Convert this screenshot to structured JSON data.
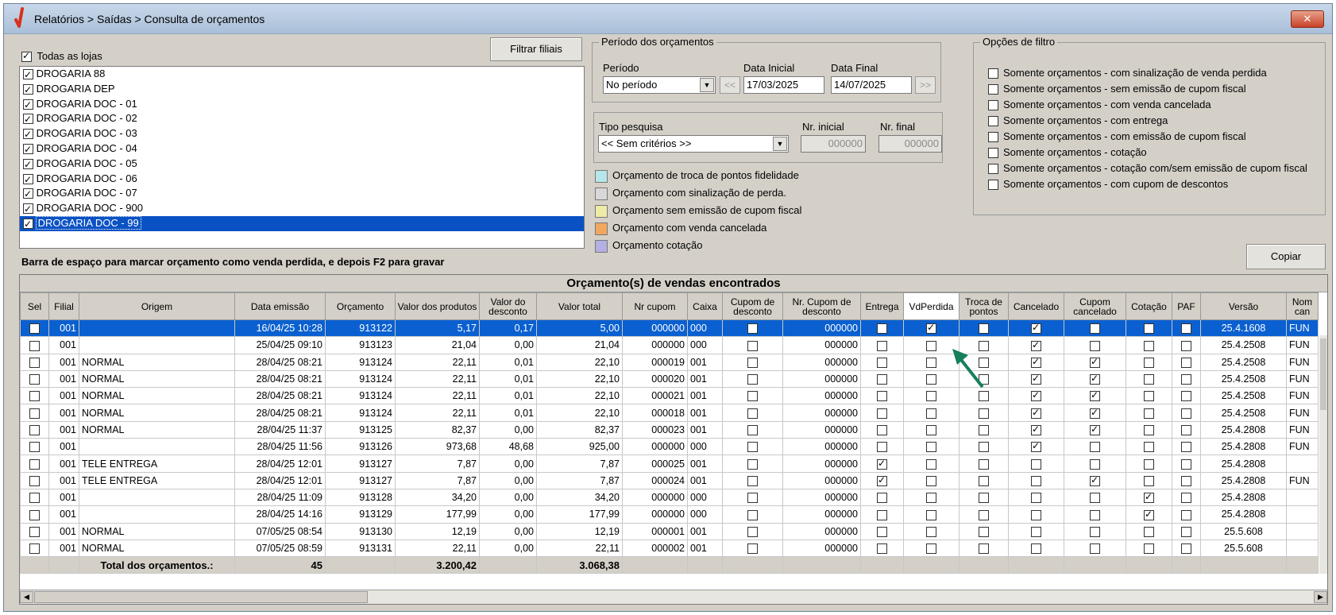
{
  "window": {
    "title": "Relatórios > Saídas > Consulta de orçamentos",
    "close_label": "✕"
  },
  "stores": {
    "all_label": "Todas as lojas",
    "all_checked": true,
    "filter_button": "Filtrar filiais",
    "items": [
      {
        "name": "DROGARIA 88",
        "checked": true
      },
      {
        "name": "DROGARIA DEP",
        "checked": true
      },
      {
        "name": "DROGARIA DOC - 01",
        "checked": true
      },
      {
        "name": "DROGARIA DOC - 02",
        "checked": true
      },
      {
        "name": "DROGARIA DOC - 03",
        "checked": true
      },
      {
        "name": "DROGARIA DOC - 04",
        "checked": true
      },
      {
        "name": "DROGARIA DOC - 05",
        "checked": true
      },
      {
        "name": "DROGARIA DOC - 06",
        "checked": true
      },
      {
        "name": "DROGARIA DOC - 07",
        "checked": true
      },
      {
        "name": "DROGARIA DOC - 900",
        "checked": true
      },
      {
        "name": "DROGARIA DOC - 99",
        "checked": true
      }
    ],
    "selected_index": 10
  },
  "period": {
    "group_title": "Período dos orçamentos",
    "period_label": "Período",
    "period_value": "No período",
    "start_label": "Data Inicial",
    "start_value": "17/03/2025",
    "end_label": "Data Final",
    "end_value": "14/07/2025",
    "prev_label": "<<",
    "next_label": ">>"
  },
  "search": {
    "type_label": "Tipo pesquisa",
    "type_value": "<< Sem critérios >>",
    "initial_label": "Nr. inicial",
    "initial_value": "000000",
    "final_label": "Nr. final",
    "final_value": "000000"
  },
  "legend": [
    {
      "label": "Orçamento de troca de pontos fidelidade",
      "color": "#b7e6ea"
    },
    {
      "label": "Orçamento com sinalização de perda.",
      "color": "#d8d8d8"
    },
    {
      "label": "Orçamento sem emissão de cupom fiscal",
      "color": "#eeeaa8"
    },
    {
      "label": "Orçamento com venda cancelada",
      "color": "#f0a860"
    },
    {
      "label": "Orçamento cotação",
      "color": "#b4b0e4"
    }
  ],
  "filters": {
    "group_title": "Opções de filtro",
    "options": [
      "Somente orçamentos - com sinalização de venda perdida",
      "Somente orçamentos - sem emissão de cupom fiscal",
      "Somente orçamentos - com venda cancelada",
      "Somente orçamentos - com entrega",
      "Somente orçamentos - com emissão de cupom fiscal",
      "Somente orçamentos - cotação",
      "Somente orçamentos - cotação com/sem emissão de cupom fiscal",
      "Somente orçamentos - com cupom de descontos"
    ]
  },
  "hint": "Barra de espaço para marcar orçamento como venda perdida, e depois F2 para gravar",
  "copy_button": "Copiar",
  "grid": {
    "caption": "Orçamento(s) de vendas encontrados",
    "columns": [
      "Sel",
      "Filial",
      "Origem",
      "Data emissão",
      "Orçamento",
      "Valor dos produtos",
      "Valor do desconto",
      "Valor total",
      "Nr cupom",
      "Caixa",
      "Cupom de desconto",
      "Nr. Cupom de desconto",
      "Entrega",
      "VdPerdida",
      "Troca de pontos",
      "Cancelado",
      "Cupom cancelado",
      "Cotação",
      "PAF",
      "Versão",
      "Nom can"
    ],
    "rows": [
      {
        "filial": "001",
        "origem": "",
        "data": "16/04/25 10:28",
        "orc": "913122",
        "vprod": "5,17",
        "vdesc": "0,17",
        "vtotal": "5,00",
        "cupom": "000000",
        "caixa": "000",
        "cupdesc": false,
        "nrcupdesc": "000000",
        "entrega": false,
        "vdperdida": true,
        "troca": false,
        "cancelado": true,
        "cupcanc": false,
        "cotacao": false,
        "paf": false,
        "versao": "25.4.1608",
        "nome": "FUN"
      },
      {
        "filial": "001",
        "origem": "",
        "data": "25/04/25 09:10",
        "orc": "913123",
        "vprod": "21,04",
        "vdesc": "0,00",
        "vtotal": "21,04",
        "cupom": "000000",
        "caixa": "000",
        "cupdesc": false,
        "nrcupdesc": "000000",
        "entrega": false,
        "vdperdida": false,
        "troca": false,
        "cancelado": true,
        "cupcanc": false,
        "cotacao": false,
        "paf": false,
        "versao": "25.4.2508",
        "nome": "FUN"
      },
      {
        "filial": "001",
        "origem": "NORMAL",
        "data": "28/04/25 08:21",
        "orc": "913124",
        "vprod": "22,11",
        "vdesc": "0,01",
        "vtotal": "22,10",
        "cupom": "000019",
        "caixa": "001",
        "cupdesc": false,
        "nrcupdesc": "000000",
        "entrega": false,
        "vdperdida": false,
        "troca": false,
        "cancelado": true,
        "cupcanc": true,
        "cotacao": false,
        "paf": false,
        "versao": "25.4.2508",
        "nome": "FUN"
      },
      {
        "filial": "001",
        "origem": "NORMAL",
        "data": "28/04/25 08:21",
        "orc": "913124",
        "vprod": "22,11",
        "vdesc": "0,01",
        "vtotal": "22,10",
        "cupom": "000020",
        "caixa": "001",
        "cupdesc": false,
        "nrcupdesc": "000000",
        "entrega": false,
        "vdperdida": false,
        "troca": false,
        "cancelado": true,
        "cupcanc": true,
        "cotacao": false,
        "paf": false,
        "versao": "25.4.2508",
        "nome": "FUN"
      },
      {
        "filial": "001",
        "origem": "NORMAL",
        "data": "28/04/25 08:21",
        "orc": "913124",
        "vprod": "22,11",
        "vdesc": "0,01",
        "vtotal": "22,10",
        "cupom": "000021",
        "caixa": "001",
        "cupdesc": false,
        "nrcupdesc": "000000",
        "entrega": false,
        "vdperdida": false,
        "troca": false,
        "cancelado": true,
        "cupcanc": true,
        "cotacao": false,
        "paf": false,
        "versao": "25.4.2508",
        "nome": "FUN"
      },
      {
        "filial": "001",
        "origem": "NORMAL",
        "data": "28/04/25 08:21",
        "orc": "913124",
        "vprod": "22,11",
        "vdesc": "0,01",
        "vtotal": "22,10",
        "cupom": "000018",
        "caixa": "001",
        "cupdesc": false,
        "nrcupdesc": "000000",
        "entrega": false,
        "vdperdida": false,
        "troca": false,
        "cancelado": true,
        "cupcanc": true,
        "cotacao": false,
        "paf": false,
        "versao": "25.4.2508",
        "nome": "FUN"
      },
      {
        "filial": "001",
        "origem": "NORMAL",
        "data": "28/04/25 11:37",
        "orc": "913125",
        "vprod": "82,37",
        "vdesc": "0,00",
        "vtotal": "82,37",
        "cupom": "000023",
        "caixa": "001",
        "cupdesc": false,
        "nrcupdesc": "000000",
        "entrega": false,
        "vdperdida": false,
        "troca": false,
        "cancelado": true,
        "cupcanc": true,
        "cotacao": false,
        "paf": false,
        "versao": "25.4.2808",
        "nome": "FUN"
      },
      {
        "filial": "001",
        "origem": "",
        "data": "28/04/25 11:56",
        "orc": "913126",
        "vprod": "973,68",
        "vdesc": "48,68",
        "vtotal": "925,00",
        "cupom": "000000",
        "caixa": "000",
        "cupdesc": false,
        "nrcupdesc": "000000",
        "entrega": false,
        "vdperdida": false,
        "troca": false,
        "cancelado": true,
        "cupcanc": false,
        "cotacao": false,
        "paf": false,
        "versao": "25.4.2808",
        "nome": "FUN"
      },
      {
        "filial": "001",
        "origem": "TELE ENTREGA",
        "data": "28/04/25 12:01",
        "orc": "913127",
        "vprod": "7,87",
        "vdesc": "0,00",
        "vtotal": "7,87",
        "cupom": "000025",
        "caixa": "001",
        "cupdesc": false,
        "nrcupdesc": "000000",
        "entrega": true,
        "vdperdida": false,
        "troca": false,
        "cancelado": false,
        "cupcanc": false,
        "cotacao": false,
        "paf": false,
        "versao": "25.4.2808",
        "nome": ""
      },
      {
        "filial": "001",
        "origem": "TELE ENTREGA",
        "data": "28/04/25 12:01",
        "orc": "913127",
        "vprod": "7,87",
        "vdesc": "0,00",
        "vtotal": "7,87",
        "cupom": "000024",
        "caixa": "001",
        "cupdesc": false,
        "nrcupdesc": "000000",
        "entrega": true,
        "vdperdida": false,
        "troca": false,
        "cancelado": false,
        "cupcanc": true,
        "cotacao": false,
        "paf": false,
        "versao": "25.4.2808",
        "nome": "FUN"
      },
      {
        "filial": "001",
        "origem": "",
        "data": "28/04/25 11:09",
        "orc": "913128",
        "vprod": "34,20",
        "vdesc": "0,00",
        "vtotal": "34,20",
        "cupom": "000000",
        "caixa": "000",
        "cupdesc": false,
        "nrcupdesc": "000000",
        "entrega": false,
        "vdperdida": false,
        "troca": false,
        "cancelado": false,
        "cupcanc": false,
        "cotacao": true,
        "paf": false,
        "versao": "25.4.2808",
        "nome": ""
      },
      {
        "filial": "001",
        "origem": "",
        "data": "28/04/25 14:16",
        "orc": "913129",
        "vprod": "177,99",
        "vdesc": "0,00",
        "vtotal": "177,99",
        "cupom": "000000",
        "caixa": "000",
        "cupdesc": false,
        "nrcupdesc": "000000",
        "entrega": false,
        "vdperdida": false,
        "troca": false,
        "cancelado": false,
        "cupcanc": false,
        "cotacao": true,
        "paf": false,
        "versao": "25.4.2808",
        "nome": ""
      },
      {
        "filial": "001",
        "origem": "NORMAL",
        "data": "07/05/25 08:54",
        "orc": "913130",
        "vprod": "12,19",
        "vdesc": "0,00",
        "vtotal": "12,19",
        "cupom": "000001",
        "caixa": "001",
        "cupdesc": false,
        "nrcupdesc": "000000",
        "entrega": false,
        "vdperdida": false,
        "troca": false,
        "cancelado": false,
        "cupcanc": false,
        "cotacao": false,
        "paf": false,
        "versao": "25.5.608",
        "nome": ""
      },
      {
        "filial": "001",
        "origem": "NORMAL",
        "data": "07/05/25 08:59",
        "orc": "913131",
        "vprod": "22,11",
        "vdesc": "0,00",
        "vtotal": "22,11",
        "cupom": "000002",
        "caixa": "001",
        "cupdesc": false,
        "nrcupdesc": "000000",
        "entrega": false,
        "vdperdida": false,
        "troca": false,
        "cancelado": false,
        "cupcanc": false,
        "cotacao": false,
        "paf": false,
        "versao": "25.5.608",
        "nome": ""
      }
    ],
    "selected_row": 0,
    "totals": {
      "label": "Total dos orçamentos.:",
      "count": "45",
      "vprod": "3.200,42",
      "vtotal": "3.068,38"
    }
  }
}
